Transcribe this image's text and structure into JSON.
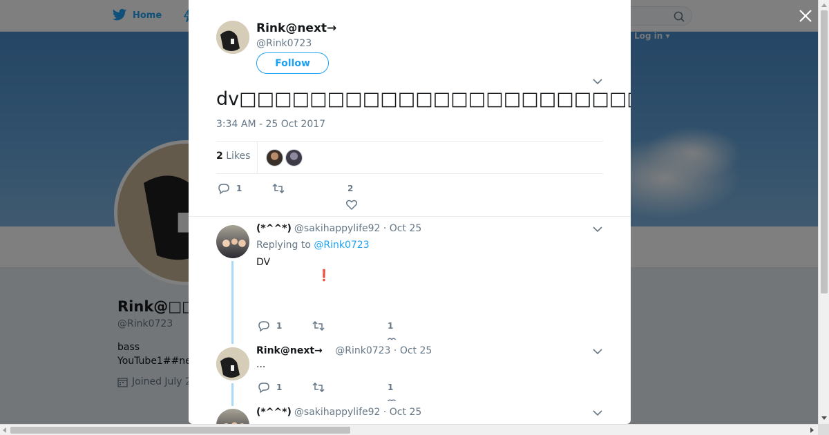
{
  "background": {
    "nav": {
      "home_label": "Home",
      "login_label": "Log in ▾"
    },
    "profile": {
      "name": "Rink@□□□",
      "handle": "@Rink0723",
      "bio_line1": "bass",
      "bio_line2": "YouTube1##ne",
      "joined": "Joined July 2"
    }
  },
  "modal": {
    "author": {
      "name": "Rink@next→",
      "handle": "@Rink0723"
    },
    "follow_label": "Follow",
    "tweet_text": "dv□□□□□□□□□□□□□□□□□□□□□□□□□□□DV□□□□□□□□□□□□□□□□□□□□□□□□□□□□□□□□□□□□□□□□□□□□□□□□□□□□□□dv□",
    "timestamp": "3:34 AM - 25 Oct 2017",
    "likes_count": "2",
    "likes_label": "Likes",
    "actions": {
      "reply_count": "1",
      "retweet_count": "",
      "like_count": "2"
    },
    "replies": [
      {
        "name": "(*^^*)",
        "handle": "@sakihappylife92",
        "date": "· Oct 25",
        "replying_prefix": "Replying to",
        "replying_to": "@Rink0723",
        "text": "DV",
        "emoji": "❗",
        "reply_count": "1",
        "like_count": "1"
      },
      {
        "name": "Rink@next→",
        "handle": "@Rink0723",
        "date": "· Oct 25",
        "text": "...",
        "reply_count": "1",
        "like_count": "1"
      },
      {
        "name": "(*^^*)",
        "handle": "@sakihappylife92",
        "date": "· Oct 25"
      }
    ]
  },
  "colors": {
    "accent": "#1da1f2",
    "text": "#14171a",
    "muted": "#657786",
    "thread": "#a8d9f7"
  },
  "icons": [
    "twitter-bird-icon",
    "moments-icon",
    "search-icon",
    "close-icon",
    "chevron-down-icon",
    "reply-icon",
    "retweet-icon",
    "heart-icon",
    "calendar-icon"
  ]
}
